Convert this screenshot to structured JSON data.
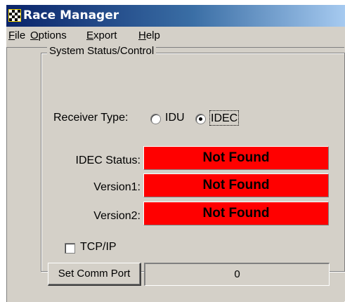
{
  "window": {
    "title": "Race Manager",
    "title_bar_color": "#0a246a"
  },
  "menu": {
    "items": [
      {
        "accel": "F",
        "rest": "ile"
      },
      {
        "accel": "O",
        "rest": "ptions"
      },
      {
        "accel": "E",
        "rest": "xport"
      },
      {
        "accel": "H",
        "rest": "elp"
      }
    ]
  },
  "group": {
    "title": "System Status/Control",
    "receiver_type_label": "Receiver Type:",
    "options": [
      {
        "label": "IDU",
        "selected": false
      },
      {
        "label": "IDEC",
        "selected": true
      }
    ],
    "status_rows": [
      {
        "label": "IDEC Status:",
        "value": "Not Found"
      },
      {
        "label": "Version1:",
        "value": "Not Found"
      },
      {
        "label": "Version2:",
        "value": "Not Found"
      }
    ],
    "status_color": "#ff0000",
    "tcpip_label": "TCP/IP",
    "tcpip_checked": false,
    "comm_button": "Set Comm Port",
    "comm_port_value": "0"
  }
}
